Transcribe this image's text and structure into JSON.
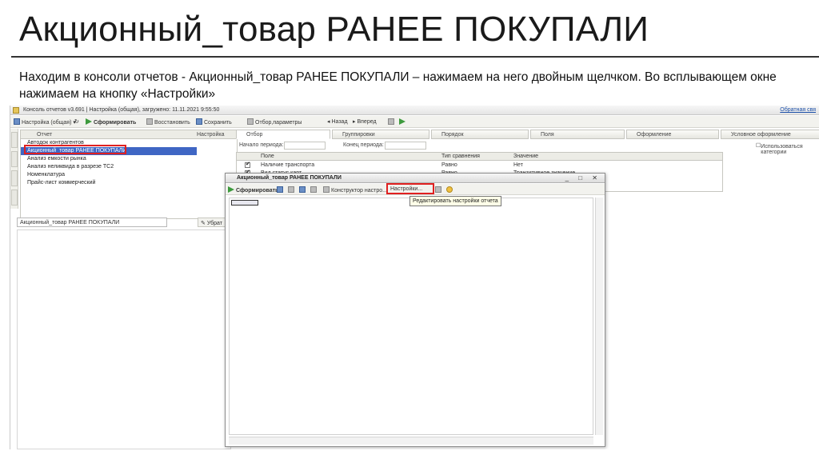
{
  "slide": {
    "title": "Акционный_товар РАНЕЕ ПОКУПАЛИ",
    "text": "Находим в консоли отчетов  - Акционный_товар РАНЕЕ ПОКУПАЛИ – нажимаем на него двойным щелчком. Во всплывающем окне нажимаем на кнопку «Настройки»"
  },
  "window": {
    "title": "Консоль отчетов v3.691 | Настройка (общая), загружено: 11.11.2021 9:55:50",
    "feedback_link": "Обратная свя"
  },
  "toolbar": {
    "settings_label": "Настройка (общая)",
    "generate_label": "Сформировать",
    "restore_label": "Восстановить",
    "save_label": "Сохранить",
    "filter_params_label": "Отбор,параметры",
    "back_label": "Назад",
    "forward_label": "Вперед"
  },
  "reports": {
    "columns": [
      "Отчет",
      "Настройка"
    ],
    "rows": [
      "Автодок контрагентов",
      "Акционный_товар РАНЕЕ ПОКУПАЛИ",
      "Анализ емкости рынка",
      "Анализ неликвида в разрезе ТС2",
      "Номенклатура",
      "Прайс-лист коммерческий"
    ],
    "selected_index": 1,
    "selected_name": "Акционный_товар РАНЕЕ ПОКУПАЛИ",
    "remove_label": "Убрат"
  },
  "settings_tabs": [
    "Отбор",
    "Группировки",
    "Порядок",
    "Поля",
    "Оформление",
    "Условное оформление"
  ],
  "period": {
    "start_label": "Начало периода:",
    "end_label": "Конец периода:",
    "categories_label": "Использоваться категории"
  },
  "filter_grid": {
    "columns": [
      "Поле",
      "Тип сравнения",
      "Значение"
    ],
    "rows": [
      {
        "field": "Наличие транспорта",
        "comparison": "Равно",
        "value": "Нет"
      },
      {
        "field": "Вид статус карт",
        "comparison": "Равно",
        "value": "Транзитивное значение"
      }
    ]
  },
  "dialog": {
    "title": "Акционный_товар РАНЕЕ ПОКУПАЛИ",
    "generate_label": "Сформировать",
    "constructor_label": "Конструктор настро...",
    "settings_label": "Настройки...",
    "tooltip": "Редактировать настройки отчета",
    "window_buttons": "_ □ ✕"
  },
  "colors": {
    "highlight": "#e02020",
    "selection": "#3f66c4"
  }
}
